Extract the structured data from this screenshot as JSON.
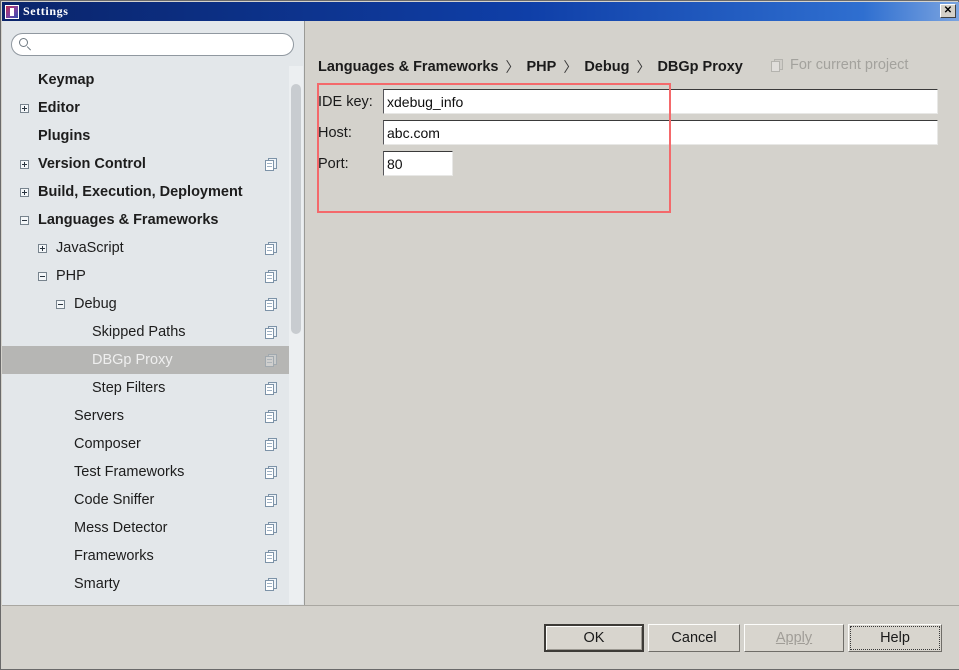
{
  "window": {
    "title": "Settings",
    "icon": "app-icon",
    "close_label": "✕"
  },
  "sidebar": {
    "search": {
      "value": "",
      "placeholder": "",
      "icon": "search-icon"
    },
    "items": [
      {
        "label": "Keymap",
        "level": 0,
        "toggle": "none",
        "copy": false,
        "selected": false
      },
      {
        "label": "Editor",
        "level": 0,
        "toggle": "collapsed",
        "copy": false,
        "selected": false
      },
      {
        "label": "Plugins",
        "level": 0,
        "toggle": "none",
        "copy": false,
        "selected": false
      },
      {
        "label": "Version Control",
        "level": 0,
        "toggle": "collapsed",
        "copy": true,
        "selected": false
      },
      {
        "label": "Build, Execution, Deployment",
        "level": 0,
        "toggle": "collapsed",
        "copy": false,
        "selected": false
      },
      {
        "label": "Languages & Frameworks",
        "level": 0,
        "toggle": "expanded",
        "copy": false,
        "selected": false
      },
      {
        "label": "JavaScript",
        "level": 1,
        "toggle": "collapsed",
        "copy": true,
        "selected": false
      },
      {
        "label": "PHP",
        "level": 1,
        "toggle": "expanded",
        "copy": true,
        "selected": false
      },
      {
        "label": "Debug",
        "level": 2,
        "toggle": "expanded",
        "copy": true,
        "selected": false
      },
      {
        "label": "Skipped Paths",
        "level": 3,
        "toggle": "none",
        "copy": true,
        "selected": false
      },
      {
        "label": "DBGp Proxy",
        "level": 3,
        "toggle": "none",
        "copy": true,
        "selected": true
      },
      {
        "label": "Step Filters",
        "level": 3,
        "toggle": "none",
        "copy": true,
        "selected": false
      },
      {
        "label": "Servers",
        "level": 2,
        "toggle": "none",
        "copy": true,
        "selected": false
      },
      {
        "label": "Composer",
        "level": 2,
        "toggle": "none",
        "copy": true,
        "selected": false
      },
      {
        "label": "Test Frameworks",
        "level": 2,
        "toggle": "none",
        "copy": true,
        "selected": false
      },
      {
        "label": "Code Sniffer",
        "level": 2,
        "toggle": "none",
        "copy": true,
        "selected": false
      },
      {
        "label": "Mess Detector",
        "level": 2,
        "toggle": "none",
        "copy": true,
        "selected": false
      },
      {
        "label": "Frameworks",
        "level": 2,
        "toggle": "none",
        "copy": true,
        "selected": false
      },
      {
        "label": "Smarty",
        "level": 2,
        "toggle": "none",
        "copy": true,
        "selected": false
      }
    ]
  },
  "content": {
    "breadcrumb": [
      "Languages & Frameworks",
      "PHP",
      "Debug",
      "DBGp Proxy"
    ],
    "breadcrumb_separator": "〉",
    "scope": {
      "label": "For current project",
      "icon": "project-scope-icon"
    },
    "form": {
      "ide_key": {
        "label": "IDE key:",
        "value": "xdebug_info",
        "placeholder": ""
      },
      "host": {
        "label": "Host:",
        "value": "abc.com",
        "placeholder": ""
      },
      "port": {
        "label": "Port:",
        "value": "80",
        "placeholder": ""
      }
    }
  },
  "footer": {
    "ok": "OK",
    "cancel": "Cancel",
    "apply": "Apply",
    "help": "Help"
  },
  "colors": {
    "titlebar_start": "#0a246a",
    "panel_bg": "#d4d2cc",
    "sidebar_bg": "#e3e7ea",
    "selection_bg": "#b6b6b4",
    "annotation_red": "#f4696b",
    "disabled_text": "#a09d97"
  }
}
